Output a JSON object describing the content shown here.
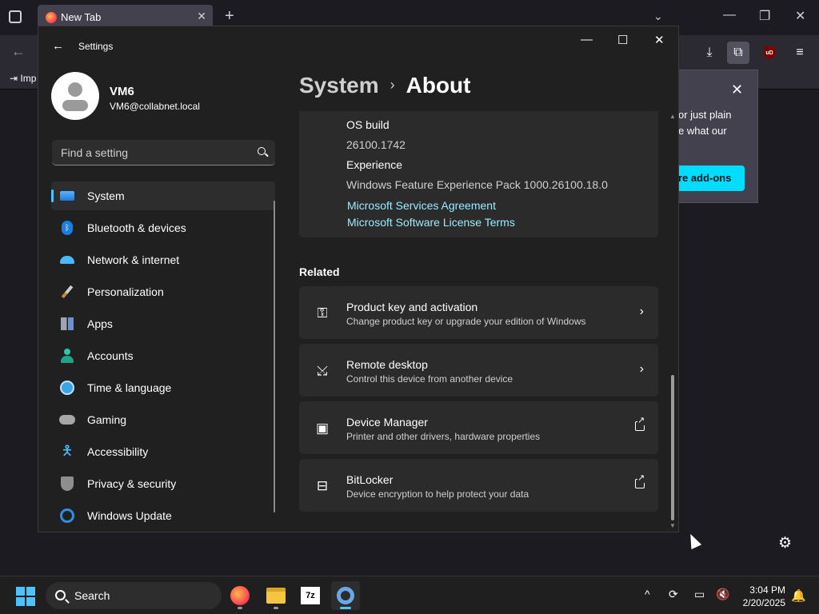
{
  "firefox": {
    "tab_title": "New Tab",
    "import_label": "Imp",
    "popup_text_line1": "or just plain",
    "popup_text_line2": "e what our",
    "popup_button": "re add-ons"
  },
  "settings": {
    "window_title": "Settings",
    "profile": {
      "name": "VM6",
      "email": "VM6@collabnet.local"
    },
    "search": {
      "placeholder": "Find a setting"
    },
    "nav": [
      {
        "label": "System",
        "icon": "monitor-icon",
        "active": true
      },
      {
        "label": "Bluetooth & devices",
        "icon": "bluetooth-icon"
      },
      {
        "label": "Network & internet",
        "icon": "wifi-icon"
      },
      {
        "label": "Personalization",
        "icon": "brush-icon"
      },
      {
        "label": "Apps",
        "icon": "apps-icon"
      },
      {
        "label": "Accounts",
        "icon": "person-icon"
      },
      {
        "label": "Time & language",
        "icon": "clock-globe-icon"
      },
      {
        "label": "Gaming",
        "icon": "gamepad-icon"
      },
      {
        "label": "Accessibility",
        "icon": "accessibility-icon"
      },
      {
        "label": "Privacy & security",
        "icon": "shield-icon"
      },
      {
        "label": "Windows Update",
        "icon": "update-icon"
      }
    ],
    "breadcrumb": {
      "parent": "System",
      "separator": "›",
      "current": "About"
    },
    "specs": {
      "os_build_label": "OS build",
      "os_build_value": "26100.1742",
      "experience_label": "Experience",
      "experience_value": "Windows Feature Experience Pack 1000.26100.18.0",
      "link_services": "Microsoft Services Agreement",
      "link_license": "Microsoft Software License Terms"
    },
    "related_heading": "Related",
    "related": [
      {
        "title": "Product key and activation",
        "subtitle": "Change product key or upgrade your edition of Windows",
        "icon": "key-icon",
        "action": "chevron"
      },
      {
        "title": "Remote desktop",
        "subtitle": "Control this device from another device",
        "icon": "remote-desktop-icon",
        "action": "chevron"
      },
      {
        "title": "Device Manager",
        "subtitle": "Printer and other drivers, hardware properties",
        "icon": "device-manager-icon",
        "action": "external"
      },
      {
        "title": "BitLocker",
        "subtitle": "Device encryption to help protect your data",
        "icon": "bitlocker-icon",
        "action": "external"
      }
    ],
    "accent_color": "#4cc2ff",
    "link_color": "#99ebff"
  },
  "taskbar": {
    "search_label": "Search",
    "time": "3:04 PM",
    "date": "2/20/2025"
  }
}
